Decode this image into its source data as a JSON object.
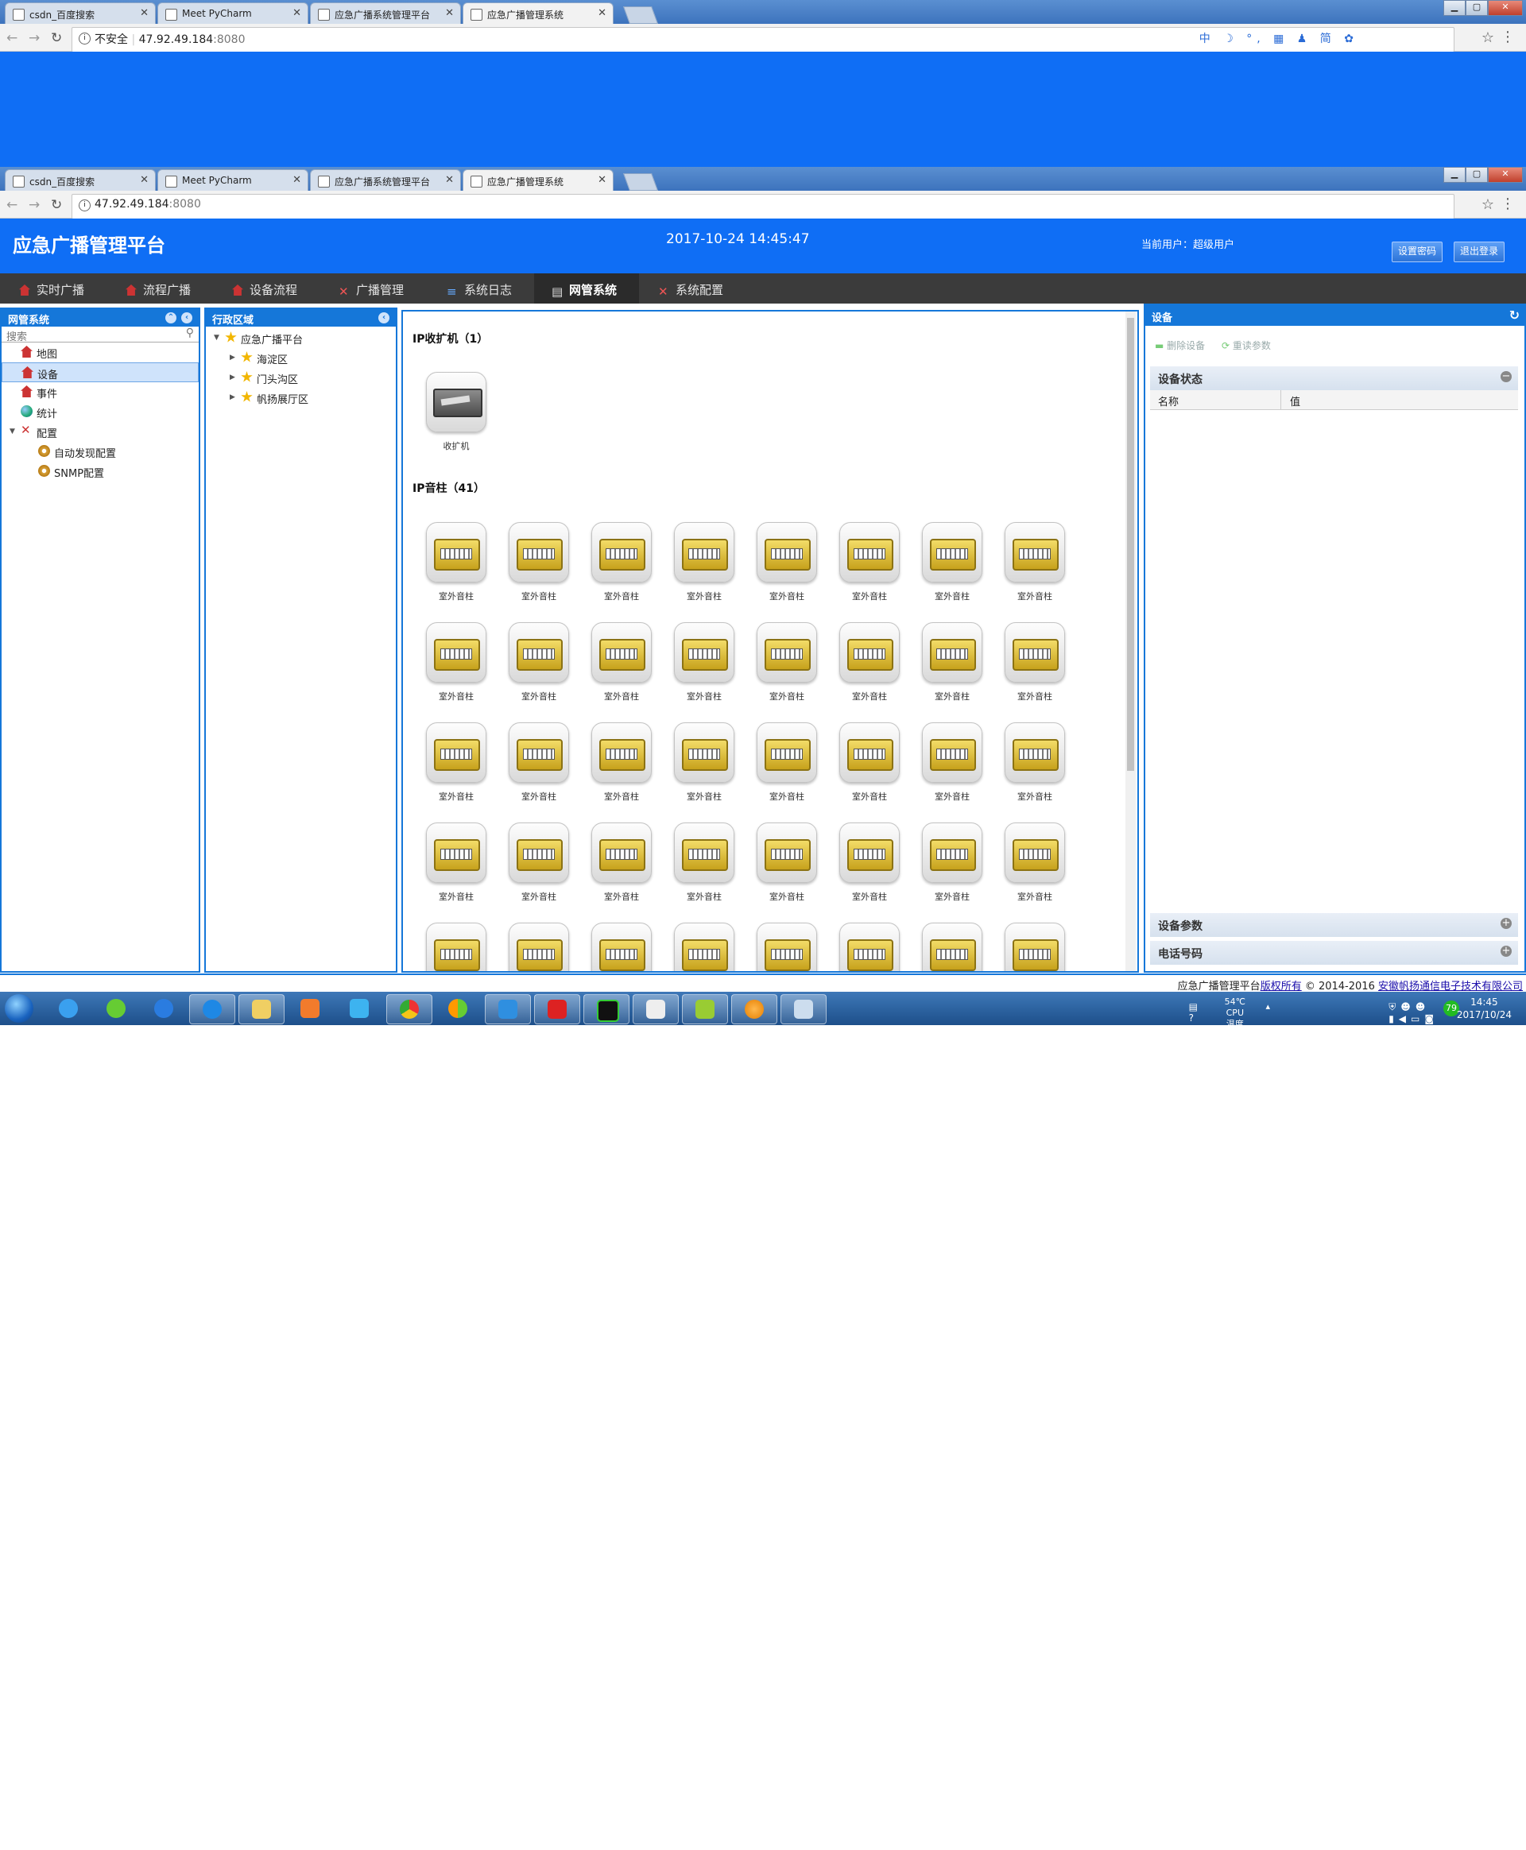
{
  "browser_tabs": [
    {
      "title": "csdn_百度搜索",
      "active": false
    },
    {
      "title": "Meet PyCharm",
      "active": false
    },
    {
      "title": "应急广播系统管理平台",
      "active": false
    },
    {
      "title": "应急广播管理系统",
      "active": true
    }
  ],
  "address_top": {
    "security": "不安全",
    "host": "47.92.49.184",
    "port": ":8080"
  },
  "address_second": {
    "host": "47.92.49.184",
    "port": ":8080"
  },
  "ime_bar": "中 ☽ °, ▦ ♟ 简 ✿",
  "header": {
    "title": "应急广播管理平台",
    "datetime": "2017-10-24  14:45:47",
    "current_user": "当前用户：超级用户",
    "btn_set_password": "设置密码",
    "btn_logout": "退出登录"
  },
  "nav": [
    {
      "label": "实时广播",
      "active": false
    },
    {
      "label": "流程广播",
      "active": false
    },
    {
      "label": "设备流程",
      "active": false
    },
    {
      "label": "广播管理",
      "active": false
    },
    {
      "label": "系统日志",
      "active": false
    },
    {
      "label": "网管系统",
      "active": true
    },
    {
      "label": "系统配置",
      "active": false
    }
  ],
  "left_panel": {
    "title": "网管系统",
    "search_placeholder": "搜索",
    "items": [
      {
        "label": "地图",
        "icon": "house-icon"
      },
      {
        "label": "设备",
        "icon": "house-icon",
        "selected": true
      },
      {
        "label": "事件",
        "icon": "house-icon"
      },
      {
        "label": "统计",
        "icon": "globe-icon"
      },
      {
        "label": "配置",
        "icon": "tools-icon"
      },
      {
        "label": "自动发现配置",
        "icon": "gear-icon"
      },
      {
        "label": "SNMP配置",
        "icon": "gear-icon"
      }
    ]
  },
  "region_panel": {
    "title": "行政区域",
    "root": "应急广播平台",
    "children": [
      "海淀区",
      "门头沟区",
      "帆扬展厅区"
    ]
  },
  "devices": {
    "section1_title": "IP收扩机（1）",
    "receiver_label": "收扩机",
    "section2_title": "IP音柱（41）",
    "speaker_label": "室外音柱"
  },
  "right_panel": {
    "title": "设备",
    "btn_delete": "删除设备",
    "btn_read_params": "重读参数",
    "status_section": "设备状态",
    "col_name": "名称",
    "col_value": "值",
    "params_section": "设备参数",
    "phone_section": "电话号码"
  },
  "footer": {
    "text": "应急广播管理平台",
    "rights": "版权所有",
    "copyright": "© 2014-2016",
    "company": "安徽帆扬通信电子技术有限公司"
  },
  "taskbar": {
    "temp": "54℃",
    "temp_label": "CPU温度",
    "time": "14:45",
    "date": "2017/10/24",
    "badge": "79"
  }
}
